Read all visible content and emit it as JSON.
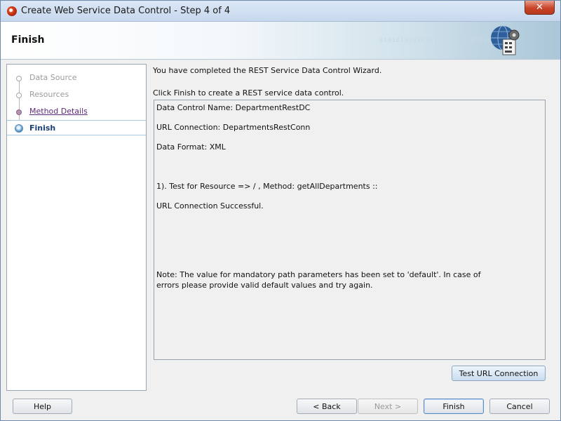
{
  "window": {
    "title": "Create Web Service Data Control - Step 4 of 4",
    "close_glyph": "✕"
  },
  "header": {
    "title": "Finish",
    "decoration": "0101010101010101010101010101",
    "icon": "web-service-gear-icon"
  },
  "steps": [
    {
      "label": "Data Source",
      "state": "done"
    },
    {
      "label": "Resources",
      "state": "done"
    },
    {
      "label": "Method Details",
      "state": "visited"
    },
    {
      "label": "Finish",
      "state": "current"
    }
  ],
  "content": {
    "intro": "You have completed the REST Service Data Control Wizard.",
    "instruction": "Click Finish to create a REST service data control.",
    "summary_lines": [
      "Data Control Name: DepartmentRestDC",
      "URL Connection: DepartmentsRestConn",
      "Data Format: XML",
      " 1). Test for Resource => / , Method: getAllDepartments ::",
      "URL Connection Successful.",
      "Note: The value for mandatory path parameters has been set to 'default'. In case of",
      " errors please provide valid default values and try again."
    ]
  },
  "buttons": {
    "test_url": "Test URL Connection",
    "help": "Help",
    "back": "< Back",
    "next": "Next >",
    "finish": "Finish",
    "cancel": "Cancel"
  },
  "colors": {
    "current_step": "#1a3f74",
    "visited_step": "#5c2a78",
    "close_button": "#c8442a"
  }
}
